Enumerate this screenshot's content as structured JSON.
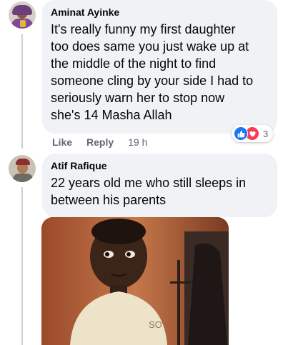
{
  "comments": [
    {
      "author": "Aminat Ayinke",
      "text": "It's really funny my first daughter\ntoo does same you just wake up at\nthe middle of the night to find\nsomeone cling by your side I had to\nseriously warn her to stop now\nshe's 14 Masha Allah",
      "actions": {
        "like": "Like",
        "reply": "Reply",
        "time": "19 h"
      },
      "reaction_count": "3",
      "reactions": [
        "like-icon",
        "love-icon"
      ]
    },
    {
      "author": "Atif Rafique",
      "text": "22 years old me who still sleeps in\nbetween his parents",
      "attachment": "photo"
    }
  ],
  "colors": {
    "bubble": "#f0f2f5",
    "secondary_text": "#65676b",
    "like_blue": "#1877f2",
    "love_red": "#f33e58"
  }
}
